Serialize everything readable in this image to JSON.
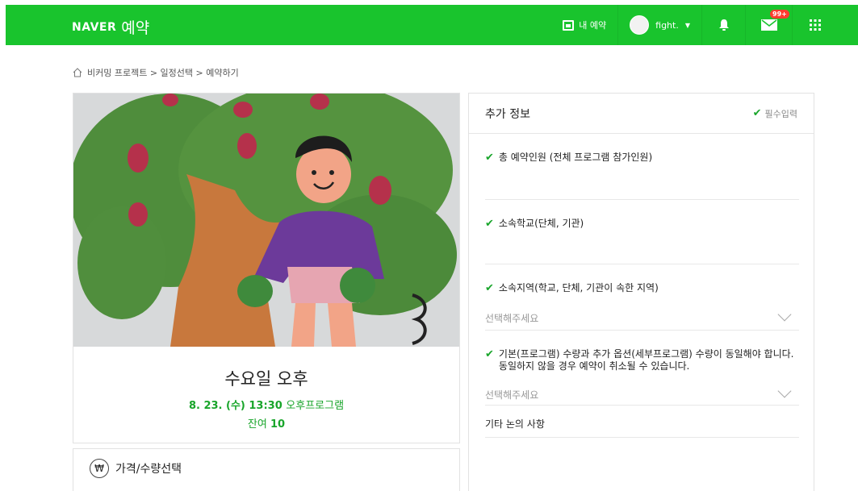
{
  "header": {
    "brand": "NAVER",
    "service": "예약",
    "my_reservation": "내 예약",
    "username": "fight.",
    "mail_badge": "99+",
    "accent_color": "#19c42d"
  },
  "breadcrumb": {
    "text": "비커밍 프로젝트 > 일정선택 > 예약하기"
  },
  "event": {
    "title": "수요일 오후",
    "date_time": "8. 23. (수) 13:30",
    "program": "오후프로그램",
    "remaining_label": "잔여",
    "remaining_value": "10"
  },
  "price_section": {
    "icon": "₩",
    "title": "가격/수량선택"
  },
  "extra_info": {
    "title": "추가 정보",
    "required_label": "필수입력",
    "fields": [
      {
        "label": "총 예약인원 (전체 프로그램 참가인원)"
      },
      {
        "label": "소속학교(단체, 기관)"
      },
      {
        "label": "소속지역(학교, 단체, 기관이 속한 지역)",
        "placeholder": "선택해주세요"
      },
      {
        "label": "기본(프로그램) 수량과 추가 옵션(세부프로그램) 수량이 동일해야 합니다. 동일하지 않을 경우 예약이 취소될 수 있습니다.",
        "placeholder": "선택해주세요"
      }
    ],
    "other_label": "기타 논의 사항"
  }
}
